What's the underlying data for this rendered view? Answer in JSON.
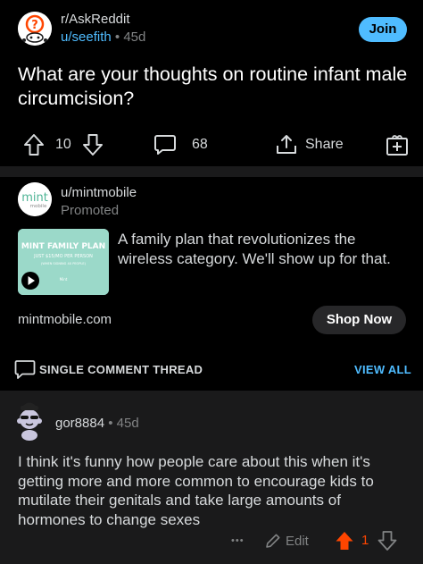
{
  "post": {
    "subreddit": "r/AskReddit",
    "username": "u/seefith",
    "age": "45d",
    "join_label": "Join",
    "title": "What are your thoughts on routine infant male circumcision?",
    "vote_count": "10",
    "comment_count": "68",
    "share_label": "Share"
  },
  "ad": {
    "username": "u/mintmobile",
    "promoted_label": "Promoted",
    "logo_text": "mint",
    "logo_subtext": "mobile",
    "thumb_title": "MINT FAMILY PLAN",
    "thumb_sub": "JUST $15/MO PER PERSON",
    "thumb_fine": "(WHEN SIGNING 4X PEOPLE)",
    "thumb_brand": "Mint",
    "text": "A family plan that revolutionizes the wireless category. We'll show up for that.",
    "domain": "mintmobile.com",
    "cta_label": "Shop Now"
  },
  "thread": {
    "label": "SINGLE COMMENT THREAD",
    "view_all_label": "VIEW ALL"
  },
  "comment": {
    "username": "gor8884",
    "age": "45d",
    "body": "I think it's funny how people care about this when it's getting more and more common to encourage kids to mutilate their genitals and take large amounts of hormones to change sexes",
    "more_label": "•••",
    "edit_label": "Edit",
    "vote_count": "1"
  },
  "colors": {
    "accent": "#4fbcff",
    "upvote": "#ff4500",
    "background": "#000000",
    "card": "#1a1a1b",
    "text": "#d7dadc",
    "muted": "#818384"
  },
  "icons": [
    "snoo-question-avatar",
    "upvote-icon",
    "downvote-icon",
    "comment-icon",
    "share-icon",
    "award-icon",
    "play-icon",
    "comment-thread-icon",
    "snoo-avatar",
    "pencil-icon"
  ]
}
